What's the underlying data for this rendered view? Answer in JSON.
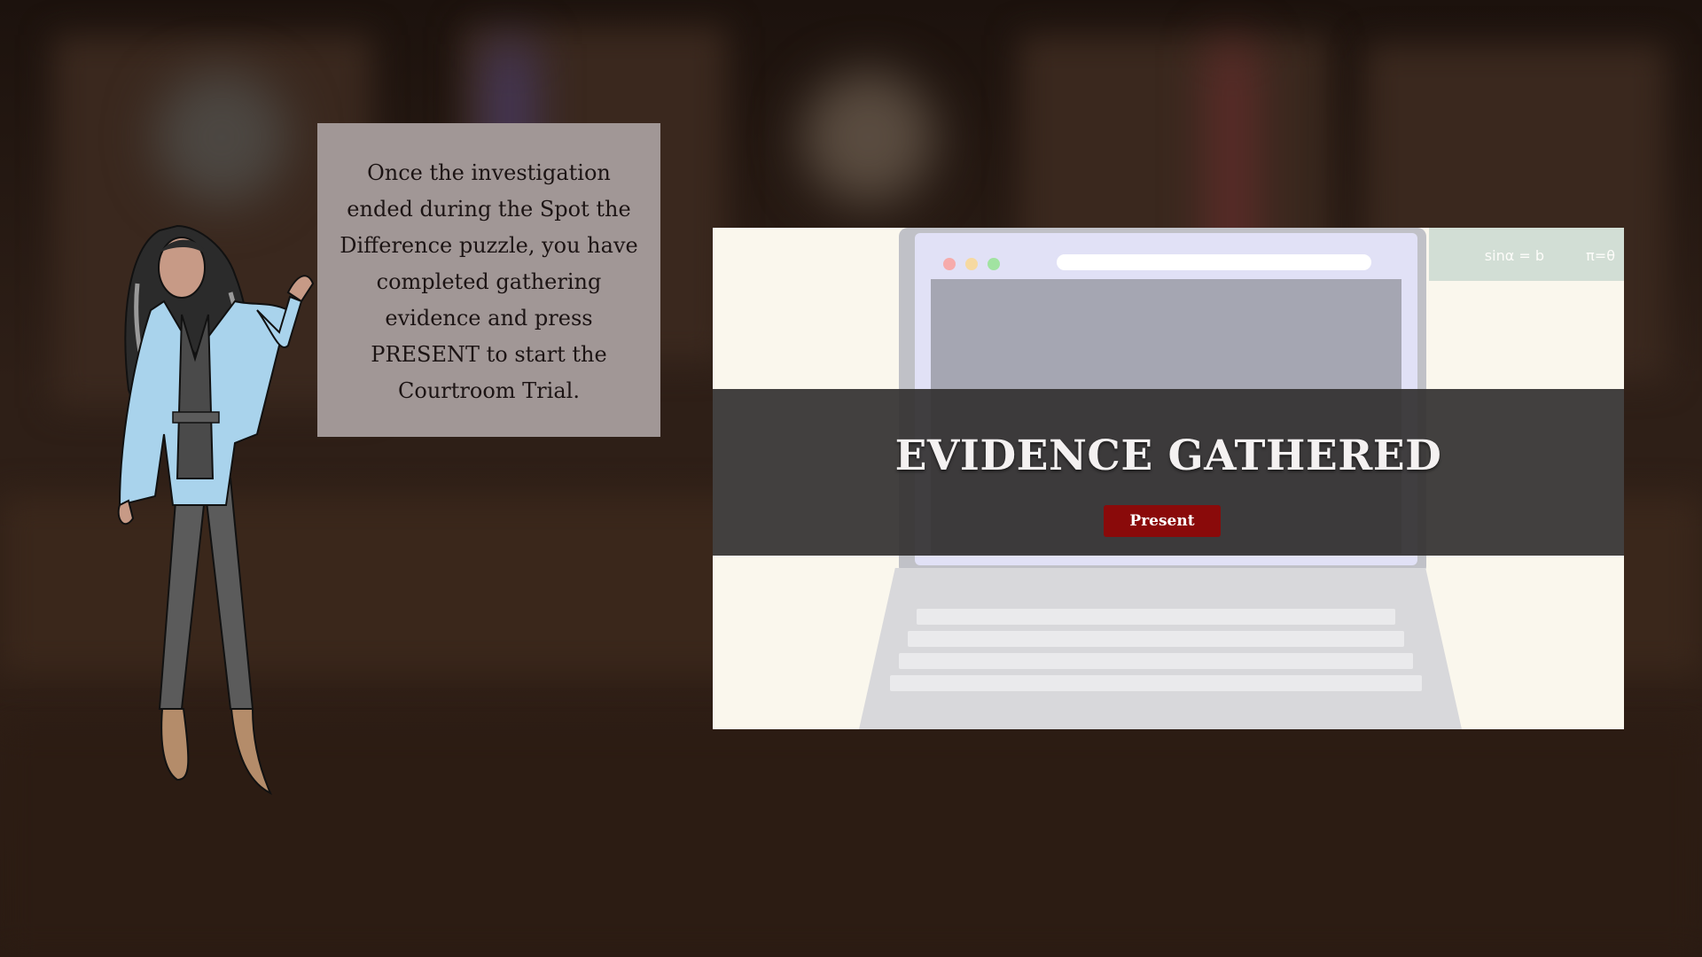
{
  "info_box": {
    "lines": [
      "Once the investigation",
      "ended during the Spot the",
      "Difference puzzle, you have",
      "completed gathering",
      "evidence and press",
      "PRESENT to start the",
      "Courtroom Trial."
    ]
  },
  "evidence": {
    "title": "EVIDENCE GATHERED",
    "present_label": "Present"
  },
  "icons": {
    "character": "teacher-character-icon"
  },
  "colors": {
    "present_button": "#8a0a0a",
    "banner": "#343232",
    "info_box": "#a19796"
  }
}
